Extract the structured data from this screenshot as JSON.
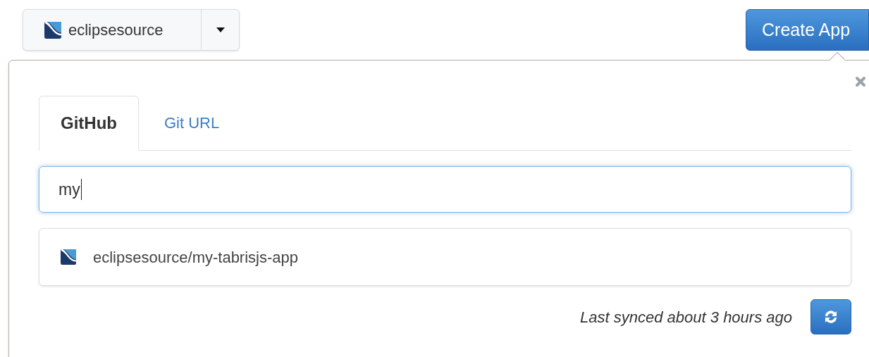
{
  "org_select": {
    "label": "eclipsesource"
  },
  "create_button": {
    "label": "Create App"
  },
  "tabs": [
    {
      "label": "GitHub",
      "selected": true
    },
    {
      "label": "Git URL",
      "selected": false
    }
  ],
  "search": {
    "value": "my"
  },
  "results": [
    {
      "label": "eclipsesource/my-tabrisjs-app"
    }
  ],
  "footer": {
    "sync_status": "Last synced about 3 hours ago"
  }
}
